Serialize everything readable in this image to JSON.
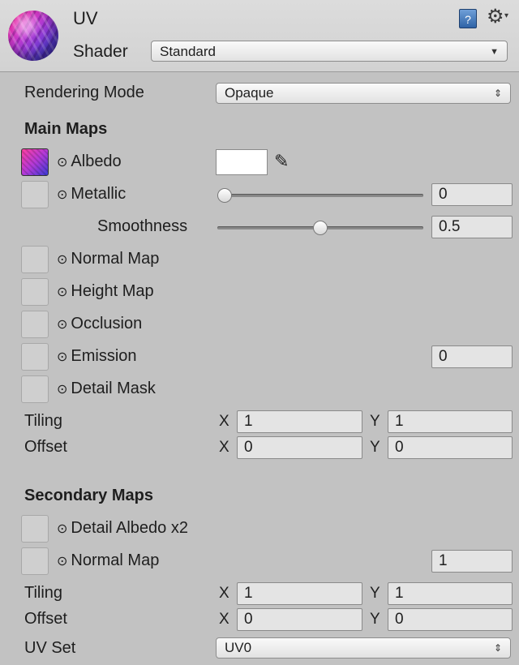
{
  "header": {
    "material_name": "UV",
    "shader_label": "Shader",
    "shader_value": "Standard",
    "icons": {
      "help": "book-help-icon",
      "settings": "gear-icon"
    }
  },
  "rendering": {
    "label": "Rendering Mode",
    "value": "Opaque"
  },
  "main_maps": {
    "title": "Main Maps",
    "albedo": "Albedo",
    "metallic": {
      "label": "Metallic",
      "value": "0",
      "slider": 0.0
    },
    "smoothness": {
      "label": "Smoothness",
      "value": "0.5",
      "slider": 0.5
    },
    "normal_map": "Normal Map",
    "height_map": "Height Map",
    "occlusion": "Occlusion",
    "emission": {
      "label": "Emission",
      "value": "0"
    },
    "detail_mask": "Detail Mask",
    "tiling": {
      "label": "Tiling",
      "x_label": "X",
      "x": "1",
      "y_label": "Y",
      "y": "1"
    },
    "offset": {
      "label": "Offset",
      "x_label": "X",
      "x": "0",
      "y_label": "Y",
      "y": "0"
    }
  },
  "secondary_maps": {
    "title": "Secondary Maps",
    "detail_albedo": "Detail Albedo x2",
    "normal_map": {
      "label": "Normal Map",
      "value": "1"
    },
    "tiling": {
      "label": "Tiling",
      "x_label": "X",
      "x": "1",
      "y_label": "Y",
      "y": "1"
    },
    "offset": {
      "label": "Offset",
      "x_label": "X",
      "x": "0",
      "y_label": "Y",
      "y": "0"
    },
    "uv_set": {
      "label": "UV Set",
      "value": "UV0"
    }
  },
  "glyphs": {
    "prop_icon": "⊙",
    "dd_arrow": "▼",
    "dd_updown": "⇕",
    "gear": "⚙",
    "caret": "▾",
    "book": "?",
    "eyedropper": "✎"
  }
}
